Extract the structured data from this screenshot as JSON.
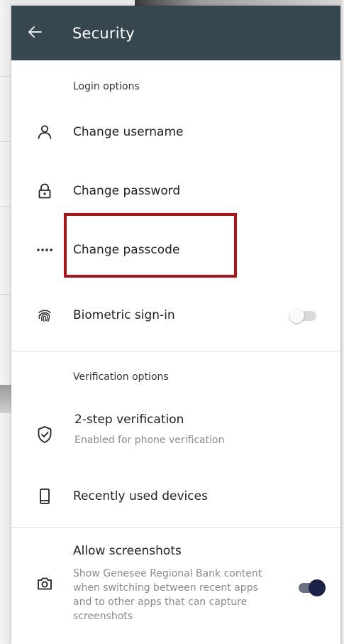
{
  "header": {
    "title": "Security"
  },
  "sections": {
    "login": {
      "label": "Login options",
      "items": [
        {
          "label": "Change username",
          "icon": "user-icon"
        },
        {
          "label": "Change password",
          "icon": "lock-icon"
        },
        {
          "label": "Change passcode",
          "icon": "passcode-dots-icon"
        },
        {
          "label": "Biometric sign-in",
          "icon": "fingerprint-icon",
          "toggle": false
        }
      ]
    },
    "verification": {
      "label": "Verification options",
      "items": [
        {
          "label": "2-step verification",
          "sublabel": "Enabled for phone verification",
          "icon": "shield-check-icon"
        },
        {
          "label": "Recently used devices",
          "icon": "phone-device-icon"
        }
      ]
    },
    "screenshots": {
      "label": "Allow screenshots",
      "description_lines": [
        "Show Genesee Regional Bank content",
        "when switching between recent apps",
        "and to other apps that can capture",
        "screenshots"
      ],
      "icon": "camera-icon",
      "toggle": true
    }
  },
  "colors": {
    "appbar": "#37474f",
    "highlight": "#b0121b",
    "toggle_on": "#1c2147",
    "toggle_off": "#d9d9d9"
  }
}
